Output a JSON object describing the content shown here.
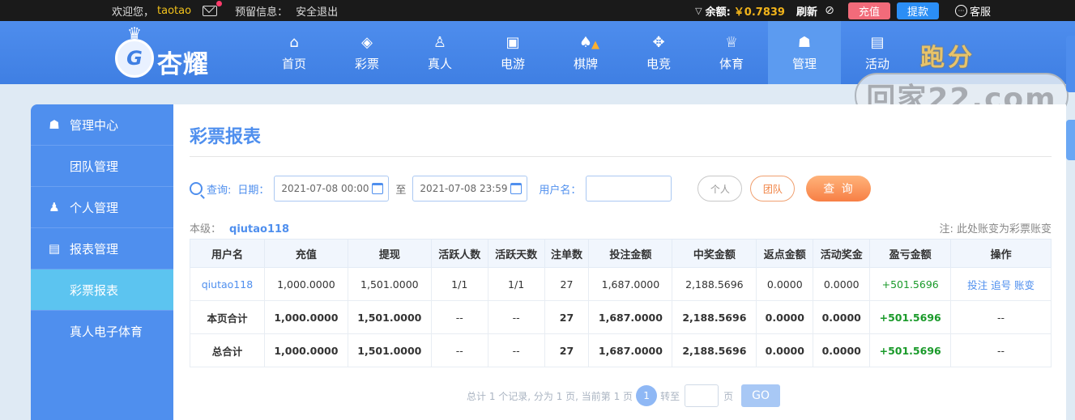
{
  "topbar": {
    "welcome": "欢迎您，",
    "username": "taotao",
    "notice_label": "预留信息：",
    "logout": "安全退出",
    "balance_label": "余额:",
    "balance_value": "￥0.7839",
    "refresh": "刷新",
    "recharge": "充值",
    "withdraw": "提款",
    "service": "客服"
  },
  "brand": {
    "logo_text": "杏耀"
  },
  "nav": {
    "items": [
      {
        "label": "首页",
        "icon": "home-icon"
      },
      {
        "label": "彩票",
        "icon": "ticket-icon"
      },
      {
        "label": "真人",
        "icon": "person-icon"
      },
      {
        "label": "电游",
        "icon": "arcade-icon"
      },
      {
        "label": "棋牌",
        "icon": "cards-icon"
      },
      {
        "label": "电竞",
        "icon": "gamepad-icon"
      },
      {
        "label": "体育",
        "icon": "trophy-icon"
      },
      {
        "label": "管理",
        "icon": "users-icon"
      },
      {
        "label": "活动",
        "icon": "gift-icon"
      }
    ],
    "active": "管理",
    "promo": "跑分"
  },
  "watermark": "回家22.com",
  "sidebar": {
    "items": [
      {
        "label": "管理中心",
        "type": "head",
        "icon": "users-icon"
      },
      {
        "label": "团队管理",
        "type": "sub"
      },
      {
        "label": "个人管理",
        "type": "head",
        "icon": "person-icon"
      },
      {
        "label": "报表管理",
        "type": "head",
        "icon": "report-icon"
      },
      {
        "label": "彩票报表",
        "type": "sub",
        "active": true
      },
      {
        "label": "真人电子体育",
        "type": "sub"
      }
    ]
  },
  "main": {
    "title": "彩票报表",
    "query_label": "查询:",
    "date_label": "日期：",
    "date_from": "2021-07-08 00:00",
    "to_label": "至",
    "date_to": "2021-07-08 23:59",
    "username_label": "用户名：",
    "username_value": "",
    "personal": "个人",
    "team": "团队",
    "query_button": "查 询",
    "level_label": "本级：",
    "level_value": "qiutao118",
    "note": "注: 此处账变为彩票账变"
  },
  "table": {
    "headers": [
      "用户名",
      "充值",
      "提现",
      "活跃人数",
      "活跃天数",
      "注单数",
      "投注金额",
      "中奖金额",
      "返点金额",
      "活动奖金",
      "盈亏金额",
      "操作"
    ],
    "rows": [
      [
        "qiutao118",
        "1,000.0000",
        "1,501.0000",
        "1/1",
        "1/1",
        "27",
        "1,687.0000",
        "2,188.5696",
        "0.0000",
        "0.0000",
        "+501.5696",
        "投注 追号 账变"
      ],
      [
        "本页合计",
        "1,000.0000",
        "1,501.0000",
        "--",
        "--",
        "27",
        "1,687.0000",
        "2,188.5696",
        "0.0000",
        "0.0000",
        "+501.5696",
        "--"
      ],
      [
        "总合计",
        "1,000.0000",
        "1,501.0000",
        "--",
        "--",
        "27",
        "1,687.0000",
        "2,188.5696",
        "0.0000",
        "0.0000",
        "+501.5696",
        "--"
      ]
    ]
  },
  "pager": {
    "summary": "总计 1 个记录, 分为 1 页, 当前第 1 页",
    "current": "1",
    "goto_label": "转至",
    "page_unit": "页",
    "go": "GO"
  },
  "colors": {
    "accent": "#4f8fee",
    "profit": "#1a9a2a",
    "recharge": "#f26b7a",
    "withdraw": "#2b8ef5",
    "balance": "#f2b41a"
  }
}
